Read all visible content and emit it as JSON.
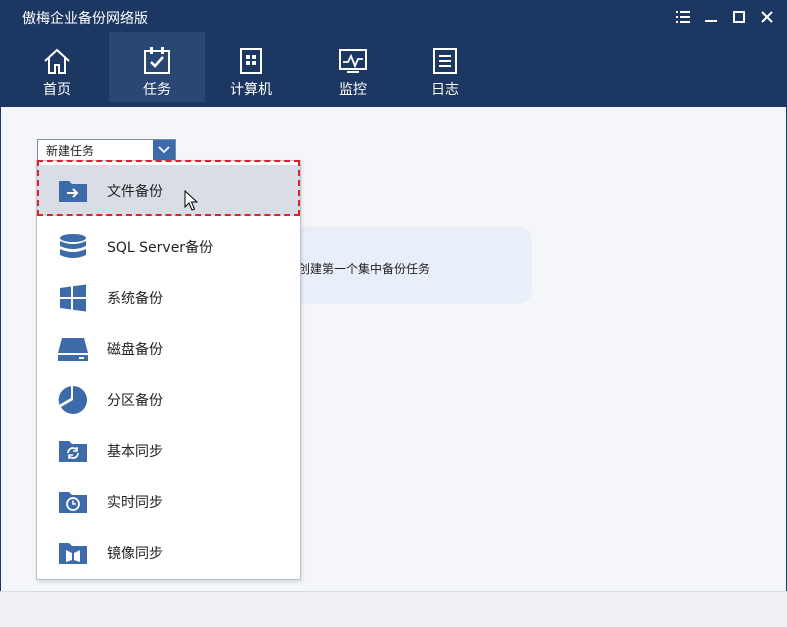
{
  "app": {
    "title": "傲梅企业备份网络版"
  },
  "window_controls": [
    {
      "name": "menu-icon"
    },
    {
      "name": "minimize-icon"
    },
    {
      "name": "maximize-icon"
    },
    {
      "name": "close-icon"
    }
  ],
  "nav": {
    "items": [
      {
        "label": "首页",
        "icon": "home-icon",
        "active": false
      },
      {
        "label": "任务",
        "icon": "task-icon",
        "active": true
      },
      {
        "label": "计算机",
        "icon": "computer-icon",
        "active": false
      },
      {
        "label": "监控",
        "icon": "monitor-icon",
        "active": false
      },
      {
        "label": "日志",
        "icon": "log-icon",
        "active": false
      }
    ]
  },
  "main": {
    "new_task_label": "新建任务",
    "empty_hint": "创建第一个集中备份任务"
  },
  "menu": {
    "items": [
      {
        "label": "文件备份",
        "icon": "folder-arrow-icon",
        "selected": true
      },
      {
        "label": "SQL Server备份",
        "icon": "database-icon",
        "selected": false
      },
      {
        "label": "系统备份",
        "icon": "windows-icon",
        "selected": false
      },
      {
        "label": "磁盘备份",
        "icon": "disk-icon",
        "selected": false
      },
      {
        "label": "分区备份",
        "icon": "pie-icon",
        "selected": false
      },
      {
        "label": "基本同步",
        "icon": "folder-sync-icon",
        "selected": false
      },
      {
        "label": "实时同步",
        "icon": "folder-clock-icon",
        "selected": false
      },
      {
        "label": "镜像同步",
        "icon": "folder-mirror-icon",
        "selected": false
      }
    ]
  },
  "colors": {
    "header_bg": "#1c3761",
    "nav_active_bg": "#2a4773",
    "icon_blue": "#3d6aa8",
    "highlight_red": "#e0202a"
  }
}
